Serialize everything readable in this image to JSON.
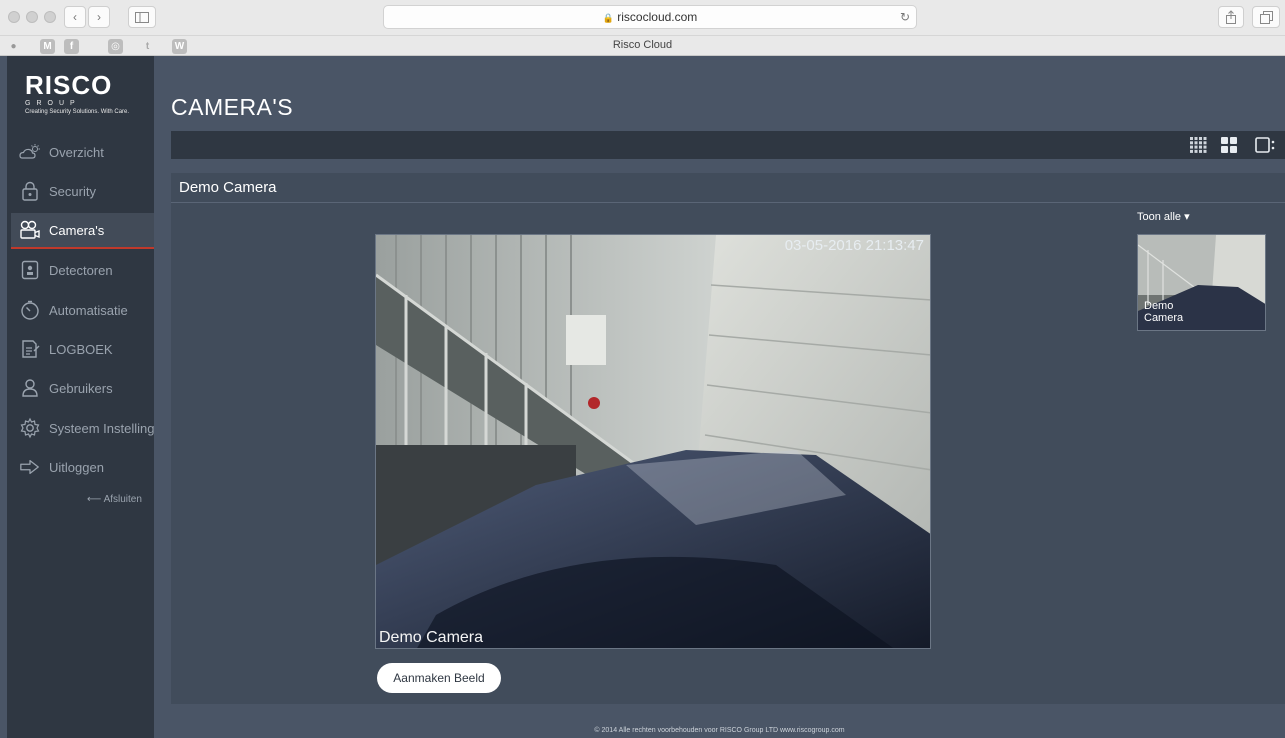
{
  "browser": {
    "url": "riscocloud.com",
    "tab_title": "Risco Cloud",
    "lock_glyph": "🔒"
  },
  "sidebar": {
    "logo": {
      "brand": "RISCO",
      "group": "GROUP",
      "tagline": "Creating Security Solutions. With Care."
    },
    "items": [
      {
        "label": "Overzicht",
        "icon": "cloud-sun-icon"
      },
      {
        "label": "Security",
        "icon": "lock-icon"
      },
      {
        "label": "Camera's",
        "icon": "camera-icon",
        "active": true
      },
      {
        "label": "Detectoren",
        "icon": "detector-icon"
      },
      {
        "label": "Automatisatie",
        "icon": "timer-icon"
      },
      {
        "label": "LOGBOEK",
        "icon": "log-icon"
      },
      {
        "label": "Gebruikers",
        "icon": "user-icon"
      },
      {
        "label": "Systeem Instellingen",
        "icon": "gear-icon"
      },
      {
        "label": "Uitloggen",
        "icon": "logout-icon"
      }
    ],
    "back_link": "⟵ Afsluiten"
  },
  "main": {
    "title": "CAMERA'S",
    "view_modes": [
      "grid-small-icon",
      "grid-large-icon",
      "single-view-icon"
    ],
    "panel": {
      "title": "Demo Camera",
      "feed": {
        "timestamp": "03-05-2016 21:13:47",
        "label": "Demo Camera"
      },
      "snapshot_button": "Aanmaken Beeld",
      "show_all": "Toon alle ▾",
      "thumbnail": {
        "label_line1": "Demo",
        "label_line2": "Camera"
      }
    },
    "footer": "© 2014 Alle rechten voorbehouden voor RISCO Group LTD  www.riscogroup.com"
  },
  "colors": {
    "sidebar_bg": "#2f3742",
    "main_bg": "#4a5566",
    "panel_bg": "#414c5b",
    "active_underline": "#c0392b"
  }
}
